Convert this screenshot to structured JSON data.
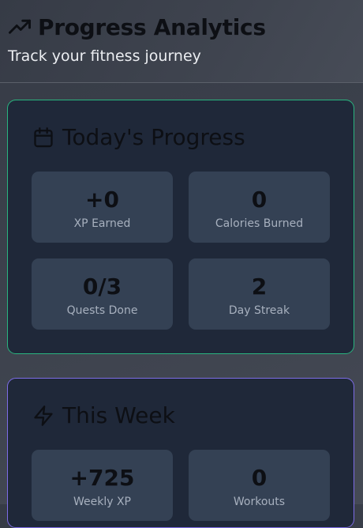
{
  "header": {
    "title": "Progress Analytics",
    "subtitle": "Track your fitness journey",
    "icon": "trending-up-icon"
  },
  "today": {
    "title": "Today's Progress",
    "icon": "calendar-icon",
    "accent_color": "#29b47f",
    "stats": [
      {
        "value": "+0",
        "label": "XP Earned"
      },
      {
        "value": "0",
        "label": "Calories Burned"
      },
      {
        "value": "0/3",
        "label": "Quests Done"
      },
      {
        "value": "2",
        "label": "Day Streak"
      }
    ]
  },
  "week": {
    "title": "This Week",
    "icon": "lightning-icon",
    "accent_color": "#7d6ce6",
    "stats": [
      {
        "value": "+725",
        "label": "Weekly XP"
      },
      {
        "value": "0",
        "label": "Workouts"
      }
    ]
  }
}
